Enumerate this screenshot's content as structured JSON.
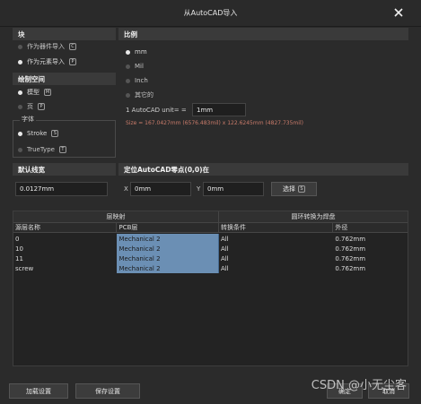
{
  "window": {
    "title": "从AutoCAD导入"
  },
  "block": {
    "header": "块",
    "options": [
      {
        "label": "作为器件导入",
        "key": "C",
        "selected": false
      },
      {
        "label": "作为元素导入",
        "key": "P",
        "selected": true
      }
    ]
  },
  "drawing_space": {
    "header": "绘制空间",
    "options": [
      {
        "label": "模型",
        "key": "M",
        "selected": true
      },
      {
        "label": "页",
        "key": "P",
        "selected": false
      }
    ]
  },
  "font": {
    "label": "字体",
    "options": [
      {
        "label": "Stroke",
        "key": "S",
        "selected": true
      },
      {
        "label": "TrueType",
        "key": "T",
        "selected": false
      }
    ]
  },
  "scale": {
    "header": "比例",
    "options": [
      {
        "label": "mm",
        "selected": true
      },
      {
        "label": "Mil",
        "selected": false
      },
      {
        "label": "Inch",
        "selected": false
      },
      {
        "label": "其它的",
        "selected": false
      }
    ],
    "unit_label": "1 AutoCAD unit= =",
    "unit_value": "1mm",
    "size_text": "Size = 167.0427mm (6576.483mil) x 122.6245mm (4827.735mil)"
  },
  "default_linewidth": {
    "header": "默认线宽",
    "value": "0.0127mm"
  },
  "origin": {
    "header": "定位AutoCAD零点(0,0)在",
    "x_label": "X",
    "x_value": "0mm",
    "y_label": "Y",
    "y_value": "0mm",
    "select_label": "选择",
    "select_key": "S"
  },
  "table": {
    "group_headers": [
      "层映射",
      "圆环转换为焊盘"
    ],
    "columns": [
      "源层名称",
      "PCB层",
      "转换条件",
      "外径"
    ],
    "rows": [
      [
        "0",
        "Mechanical 2",
        "All",
        "0.762mm"
      ],
      [
        "10",
        "Mechanical 2",
        "All",
        "0.762mm"
      ],
      [
        "11",
        "Mechanical 2",
        "All",
        "0.762mm"
      ],
      [
        "screw",
        "Mechanical 2",
        "All",
        "0.762mm"
      ]
    ]
  },
  "footer": {
    "load_label": "加载设置",
    "save_label": "保存设置",
    "ok_label": "确定",
    "cancel_label": "取消"
  },
  "watermark": "CSDN @小无尘客",
  "colors": {
    "accent_pcb_cell": "#6b8fb4",
    "size_text": "#c97b6a",
    "background": "#2b2b2b"
  },
  "icons": {
    "close": "close-icon"
  }
}
